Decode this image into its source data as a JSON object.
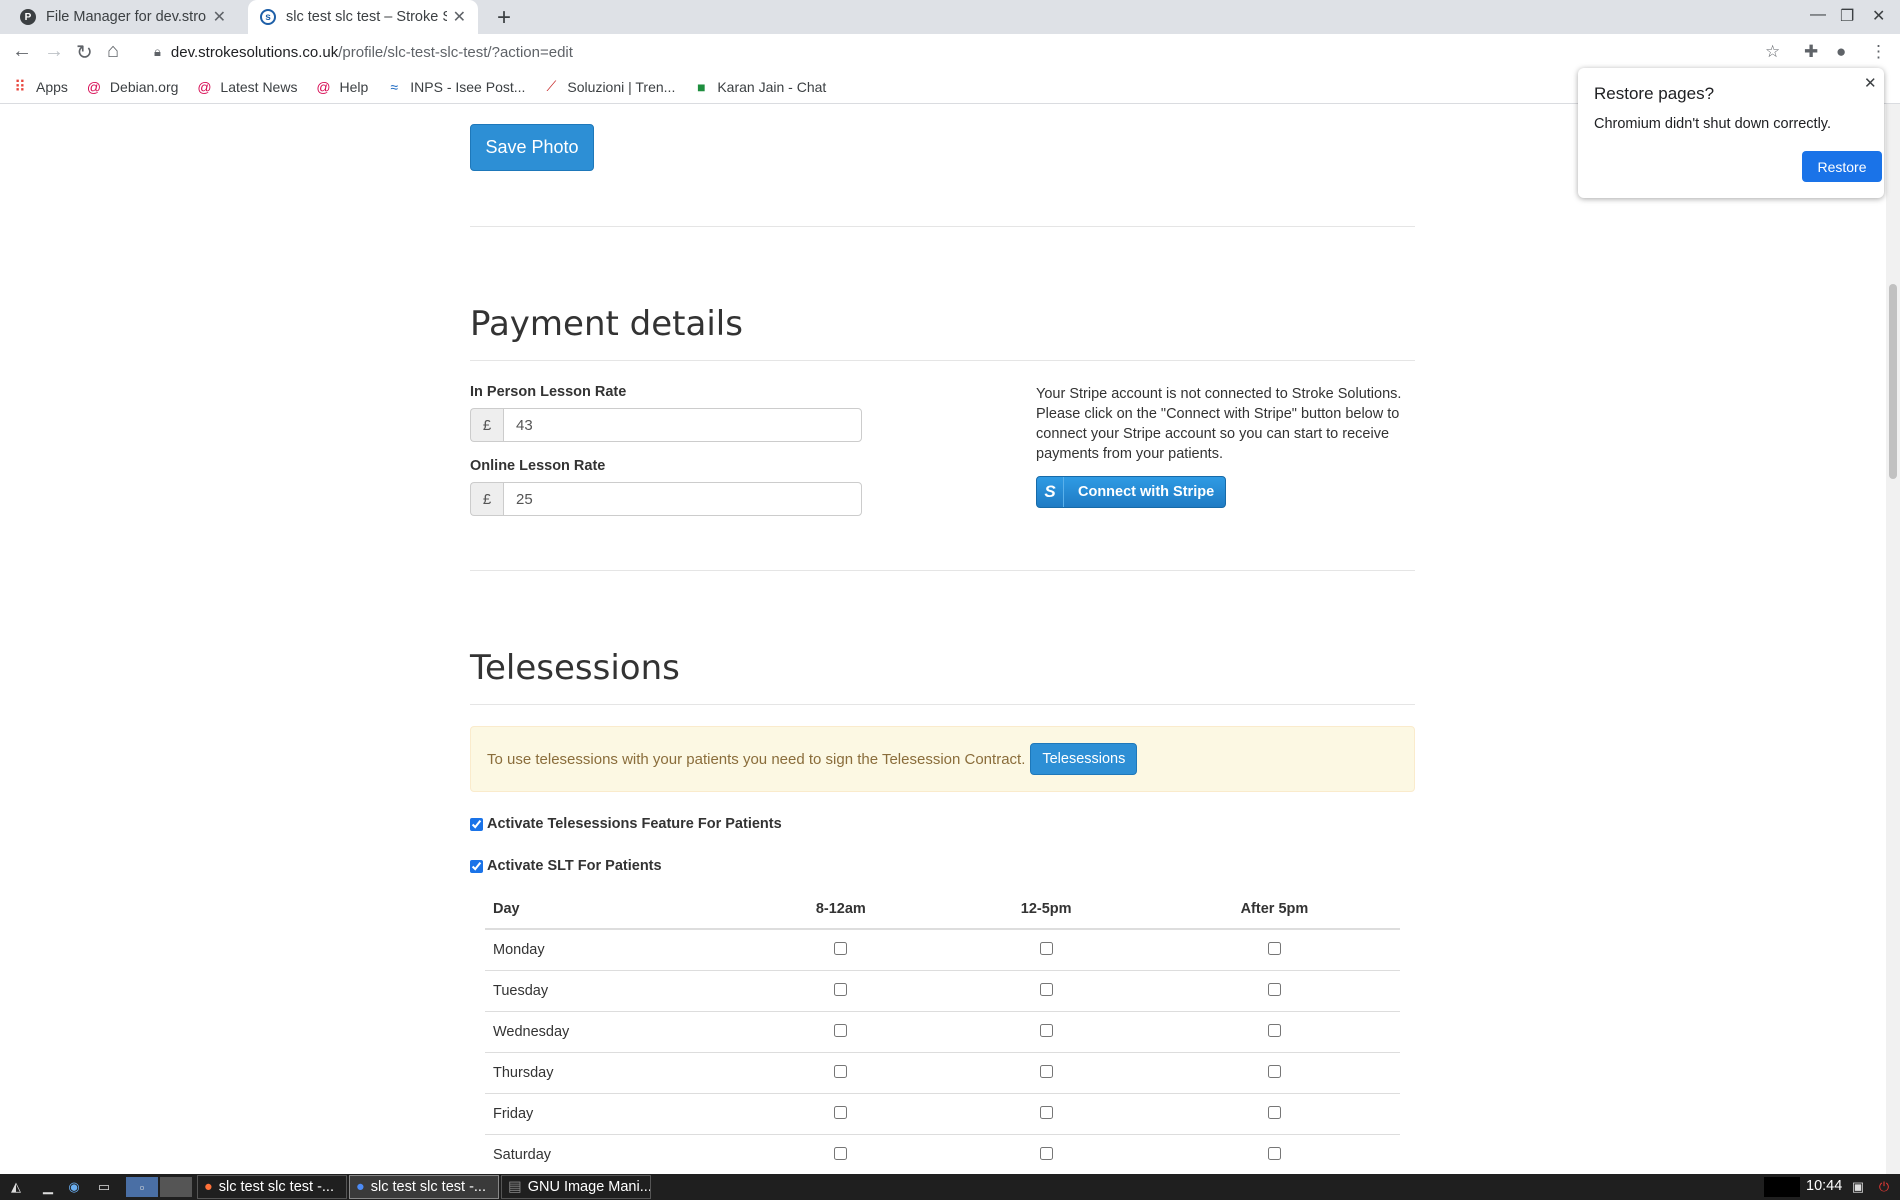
{
  "browser": {
    "tabs": [
      {
        "title": "File Manager for dev.stroke",
        "active": false
      },
      {
        "title": "slc test slc test – Stroke So",
        "active": true
      }
    ],
    "url_host": "dev.strokesolutions.co.uk",
    "url_path": "/profile/slc-test-slc-test/?action=edit",
    "bookmarks": [
      {
        "label": "Apps",
        "icon": "apps-grid-icon"
      },
      {
        "label": "Debian.org",
        "icon": "debian-icon"
      },
      {
        "label": "Latest News",
        "icon": "debian-icon"
      },
      {
        "label": "Help",
        "icon": "debian-icon"
      },
      {
        "label": "INPS - Isee Post...",
        "icon": "inps-icon"
      },
      {
        "label": "Soluzioni | Tren...",
        "icon": "trenitalia-icon"
      },
      {
        "label": "Karan Jain - Chat",
        "icon": "chat-icon"
      }
    ]
  },
  "restore_popup": {
    "title": "Restore pages?",
    "message": "Chromium didn't shut down correctly.",
    "button": "Restore"
  },
  "page": {
    "save_photo_label": "Save Photo",
    "payment": {
      "heading": "Payment details",
      "in_person_label": "In Person Lesson Rate",
      "in_person_currency": "£",
      "in_person_value": "43",
      "online_label": "Online Lesson Rate",
      "online_currency": "£",
      "online_value": "25",
      "stripe_text_1": "Your Stripe account is not connected to Stroke Solutions.",
      "stripe_text_2": "Please click on the \"Connect with Stripe\" button below to",
      "stripe_text_3": "connect your Stripe account so you can start to receive",
      "stripe_text_4": "payments from your patients.",
      "stripe_button": "Connect with Stripe",
      "stripe_logo": "S"
    },
    "telesessions": {
      "heading": "Telesessions",
      "alert_text": "To use telesessions with your patients you need to sign the Telesession Contract.",
      "alert_button": "Telesessions",
      "activate_telesessions_label": "Activate Telesessions Feature For Patients",
      "activate_telesessions_checked": true,
      "activate_slt_label": "Activate SLT For Patients",
      "activate_slt_checked": true,
      "schedule_headers": [
        "Day",
        "8-12am",
        "12-5pm",
        "After 5pm"
      ],
      "schedule_days": [
        "Monday",
        "Tuesday",
        "Wednesday",
        "Thursday",
        "Friday",
        "Saturday"
      ]
    }
  },
  "taskbar": {
    "tasks": [
      {
        "label": "slc test slc test -...",
        "icon": "firefox-icon",
        "active": false
      },
      {
        "label": "slc test slc test -...",
        "icon": "chromium-icon",
        "active": true
      },
      {
        "label": "GNU Image Mani...",
        "icon": "gimp-icon",
        "active": false
      }
    ],
    "clock": "10:44"
  }
}
